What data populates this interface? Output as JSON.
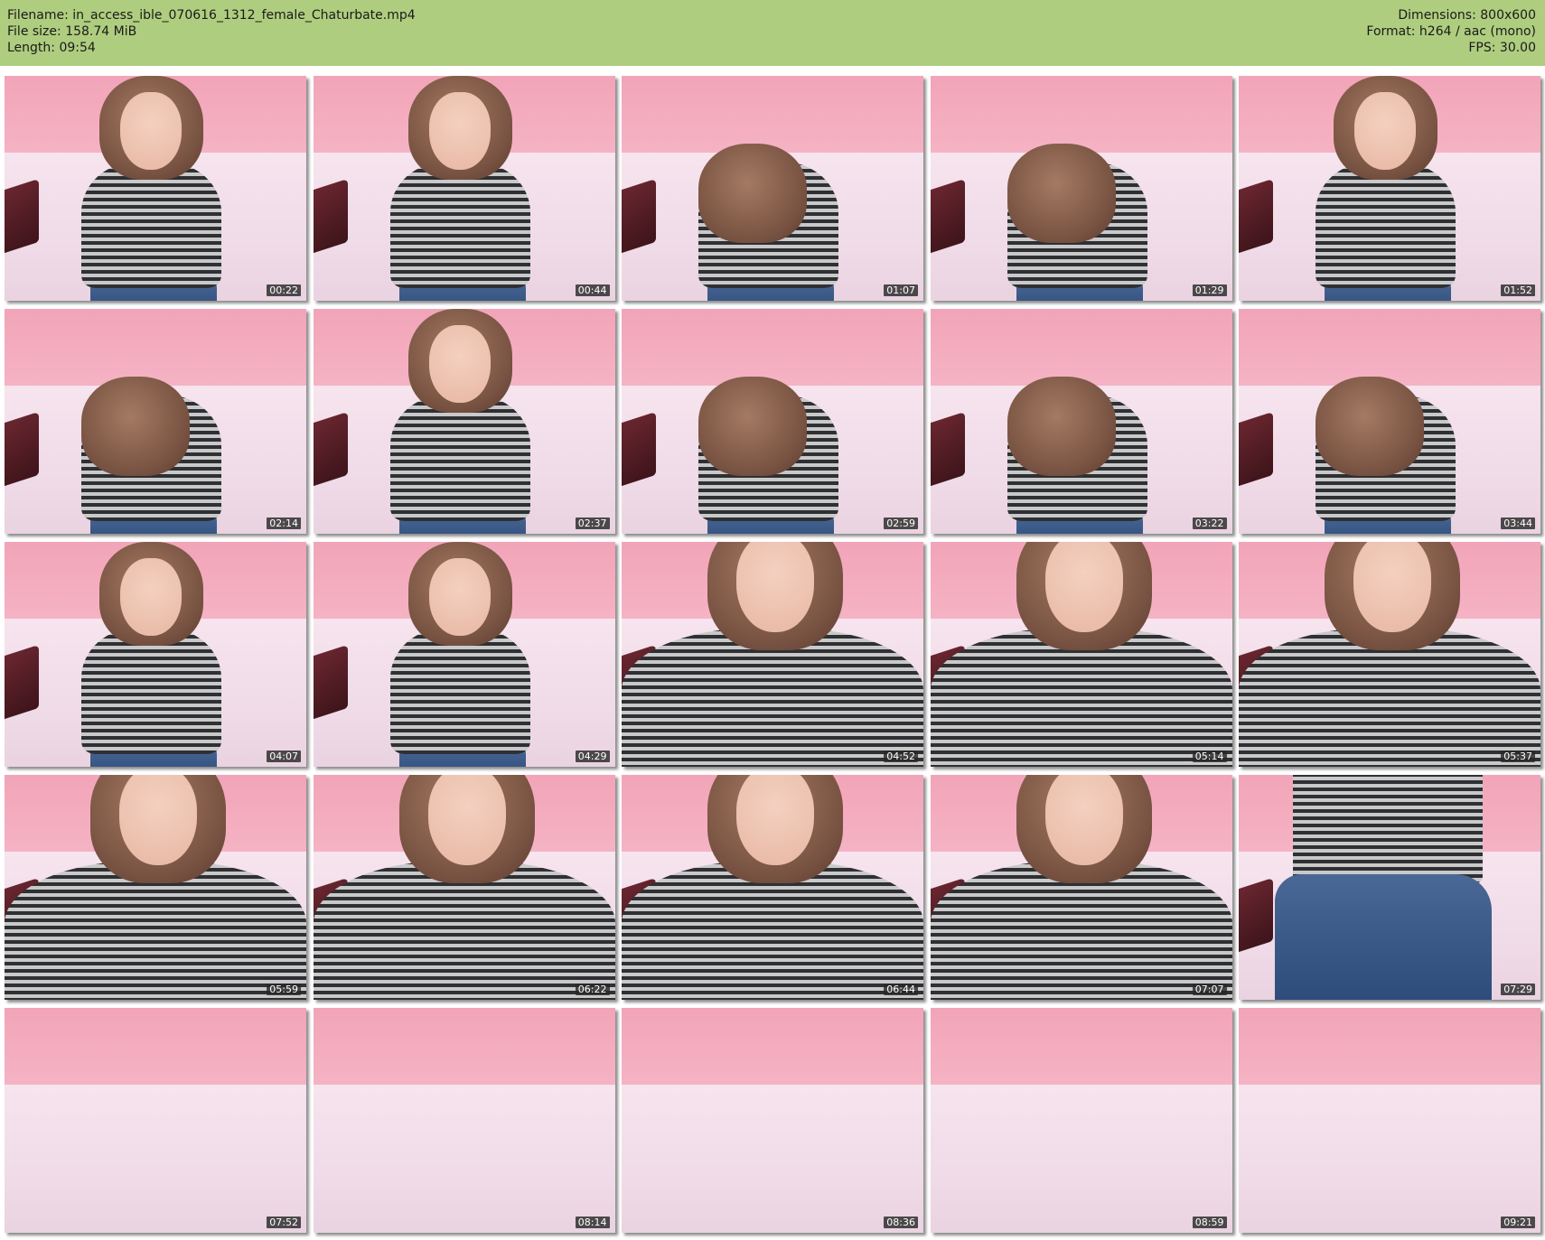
{
  "header": {
    "filename": "Filename: in_access_ible_070616_1312_female_Chaturbate.mp4",
    "filesize": "File size: 158.74 MiB",
    "length": "Length: 09:54",
    "dimensions": "Dimensions: 800x600",
    "format": "Format: h264 / aac (mono)",
    "fps": "FPS: 30.00"
  },
  "colors": {
    "header_bg": "#afcd7f",
    "wall_pink": "#f2a4b8",
    "sofa_pink": "#f0dbe8",
    "timestamp_bg": "#282828"
  },
  "thumbnails": [
    {
      "timestamp": "00:22",
      "scene": "person-seated-phone"
    },
    {
      "timestamp": "00:44",
      "scene": "person-on-call"
    },
    {
      "timestamp": "01:07",
      "scene": "person-leaning-down"
    },
    {
      "timestamp": "01:29",
      "scene": "person-leaning-down"
    },
    {
      "timestamp": "01:52",
      "scene": "person-on-call"
    },
    {
      "timestamp": "02:14",
      "scene": "person-leaning-down"
    },
    {
      "timestamp": "02:37",
      "scene": "person-on-call"
    },
    {
      "timestamp": "02:59",
      "scene": "person-leaning-down"
    },
    {
      "timestamp": "03:22",
      "scene": "person-leaning-down"
    },
    {
      "timestamp": "03:44",
      "scene": "person-leaning-down"
    },
    {
      "timestamp": "04:07",
      "scene": "person-on-call"
    },
    {
      "timestamp": "04:29",
      "scene": "person-seated-phone"
    },
    {
      "timestamp": "04:52",
      "scene": "person-closeup"
    },
    {
      "timestamp": "05:14",
      "scene": "person-closeup"
    },
    {
      "timestamp": "05:37",
      "scene": "person-closeup"
    },
    {
      "timestamp": "05:59",
      "scene": "person-closeup"
    },
    {
      "timestamp": "06:22",
      "scene": "person-closeup"
    },
    {
      "timestamp": "06:44",
      "scene": "person-closeup"
    },
    {
      "timestamp": "07:07",
      "scene": "person-closeup"
    },
    {
      "timestamp": "07:29",
      "scene": "person-standing-back"
    },
    {
      "timestamp": "07:52",
      "scene": "empty-room"
    },
    {
      "timestamp": "08:14",
      "scene": "empty-room"
    },
    {
      "timestamp": "08:36",
      "scene": "empty-room"
    },
    {
      "timestamp": "08:59",
      "scene": "empty-room"
    },
    {
      "timestamp": "09:21",
      "scene": "empty-room"
    }
  ]
}
